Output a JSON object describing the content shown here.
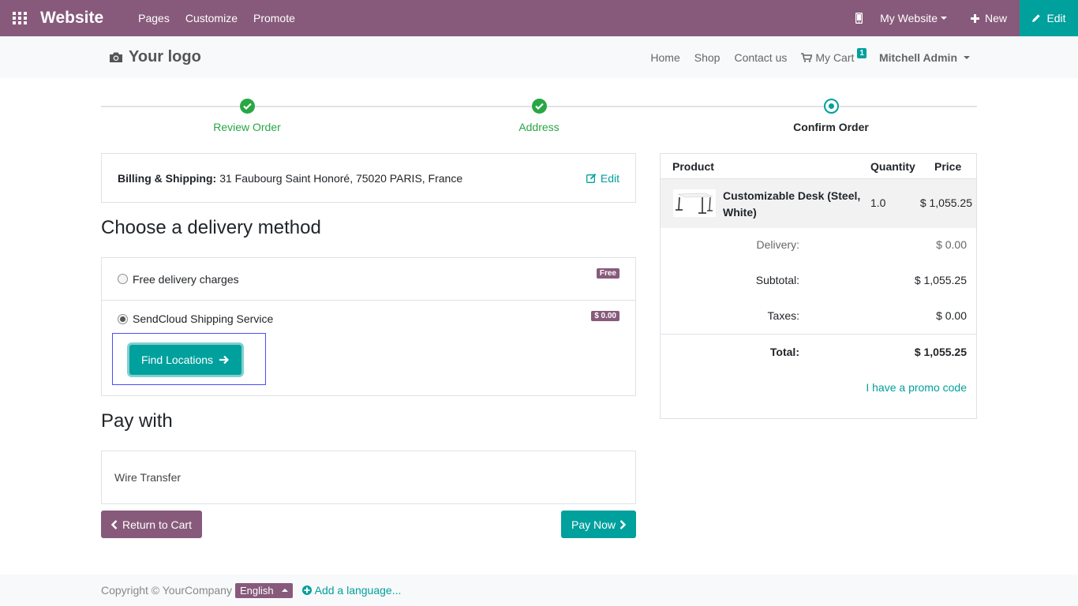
{
  "topbar": {
    "brand": "Website",
    "menu": [
      "Pages",
      "Customize",
      "Promote"
    ],
    "site_label": "My Website",
    "new_label": "New",
    "edit_label": "Edit"
  },
  "header": {
    "logo_text": "Your logo",
    "nav": [
      "Home",
      "Shop",
      "Contact us"
    ],
    "cart_label": "My Cart",
    "cart_count": "1",
    "user_name": "Mitchell Admin"
  },
  "wizard": {
    "steps": [
      {
        "label": "Review Order",
        "state": "done"
      },
      {
        "label": "Address",
        "state": "done"
      },
      {
        "label": "Confirm Order",
        "state": "current"
      }
    ]
  },
  "billing": {
    "label": "Billing & Shipping:",
    "address": "31 Faubourg Saint Honoré, 75020 PARIS, France",
    "edit_label": "Edit"
  },
  "delivery": {
    "title": "Choose a delivery method",
    "methods": [
      {
        "label": "Free delivery charges",
        "badge": "Free",
        "selected": false
      },
      {
        "label": "SendCloud Shipping Service",
        "badge": "$ 0.00",
        "selected": true
      }
    ],
    "find_button": "Find Locations"
  },
  "payment": {
    "title": "Pay with",
    "method": "Wire Transfer"
  },
  "actions": {
    "return_label": "Return to Cart",
    "pay_label": "Pay Now"
  },
  "summary": {
    "headers": [
      "Product",
      "Quantity",
      "Price"
    ],
    "product": {
      "name": "Customizable Desk (Steel, White)",
      "qty": "1.0",
      "price": "$ 1,055.25"
    },
    "delivery_label": "Delivery:",
    "delivery_value": "$ 0.00",
    "subtotal_label": "Subtotal:",
    "subtotal_value": "$ 1,055.25",
    "taxes_label": "Taxes:",
    "taxes_value": "$ 0.00",
    "total_label": "Total:",
    "total_value": "$ 1,055.25",
    "promo_label": "I have a promo code"
  },
  "footer": {
    "copyright": "Copyright © YourCompany",
    "language": "English",
    "add_language": "Add a language..."
  },
  "colors": {
    "brand": "#875a7b",
    "accent": "#00a09d",
    "success": "#28a745"
  }
}
